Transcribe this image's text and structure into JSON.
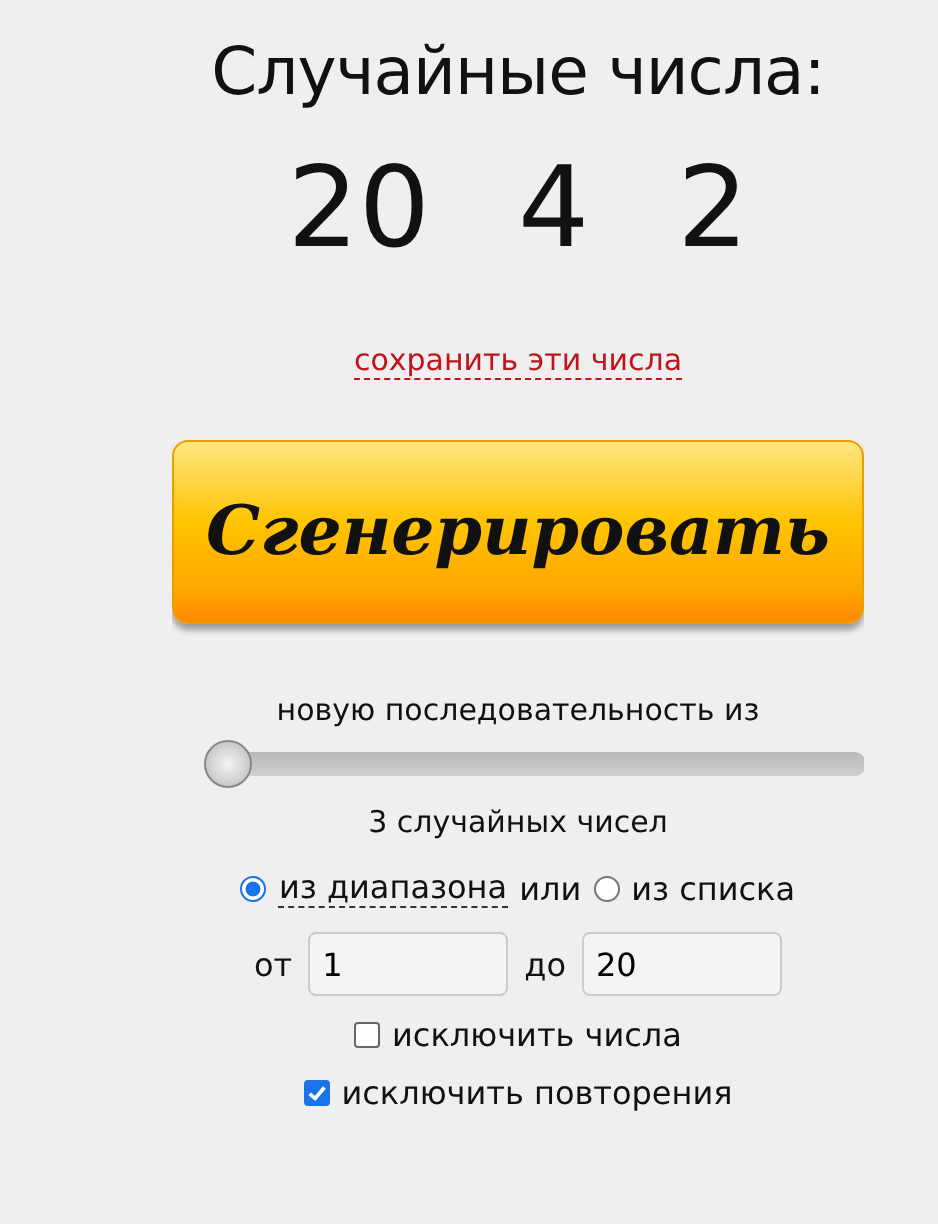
{
  "title": "Случайные числа:",
  "numbers": [
    "20",
    "4",
    "2"
  ],
  "save_link": "сохранить эти числа",
  "generate_button": "Сгенерировать",
  "sequence_label": "новую последовательность из",
  "count_slider": {
    "level": 0.02
  },
  "count_label": "3 случайных чисел",
  "source_options": [
    {
      "label": "из диапазона",
      "selected": true,
      "dashed": true
    },
    {
      "label": "из списка",
      "selected": false,
      "dashed": false
    }
  ],
  "or_text": "или",
  "range": {
    "from_label": "от",
    "from_value": "1",
    "to_label": "до",
    "to_value": "20"
  },
  "options": [
    {
      "label": "исключить числа",
      "checked": false
    },
    {
      "label": "исключить повторения",
      "checked": true
    }
  ]
}
